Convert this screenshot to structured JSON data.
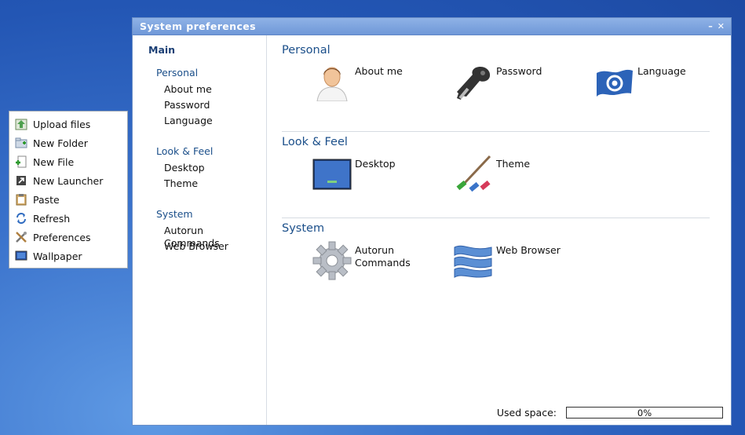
{
  "context_menu": {
    "items": [
      {
        "label": "Upload files",
        "icon": "upload-icon"
      },
      {
        "label": "New Folder",
        "icon": "new-folder-icon"
      },
      {
        "label": "New File",
        "icon": "new-file-icon"
      },
      {
        "label": "New Launcher",
        "icon": "launcher-icon"
      },
      {
        "label": "Paste",
        "icon": "clipboard-icon"
      },
      {
        "label": "Refresh",
        "icon": "refresh-icon"
      },
      {
        "label": "Preferences",
        "icon": "tools-icon"
      },
      {
        "label": "Wallpaper",
        "icon": "wallpaper-icon"
      }
    ]
  },
  "window": {
    "title": "System preferences",
    "minimize_label": "–",
    "close_label": "✕"
  },
  "sidebar": {
    "main": "Main",
    "categories": [
      {
        "label": "Personal",
        "items": [
          "About me",
          "Password",
          "Language"
        ]
      },
      {
        "label": "Look & Feel",
        "items": [
          "Desktop",
          "Theme"
        ]
      },
      {
        "label": "System",
        "items": [
          "Autorun Commands",
          "Web Browser"
        ]
      }
    ]
  },
  "sections": [
    {
      "title": "Personal",
      "tiles": [
        {
          "label": "About me",
          "icon": "person-icon"
        },
        {
          "label": "Password",
          "icon": "key-icon"
        },
        {
          "label": "Language",
          "icon": "flag-icon"
        }
      ]
    },
    {
      "title": "Look & Feel",
      "tiles": [
        {
          "label": "Desktop",
          "icon": "desktop-icon"
        },
        {
          "label": "Theme",
          "icon": "paintbrush-icon"
        }
      ]
    },
    {
      "title": "System",
      "tiles": [
        {
          "label": "Autorun\nCommands",
          "icon": "gear-icon"
        },
        {
          "label": "Web Browser",
          "icon": "waves-icon"
        }
      ]
    }
  ],
  "footer": {
    "used_space_label": "Used space:",
    "used_space_value": "0%",
    "used_space_fraction": 0
  }
}
